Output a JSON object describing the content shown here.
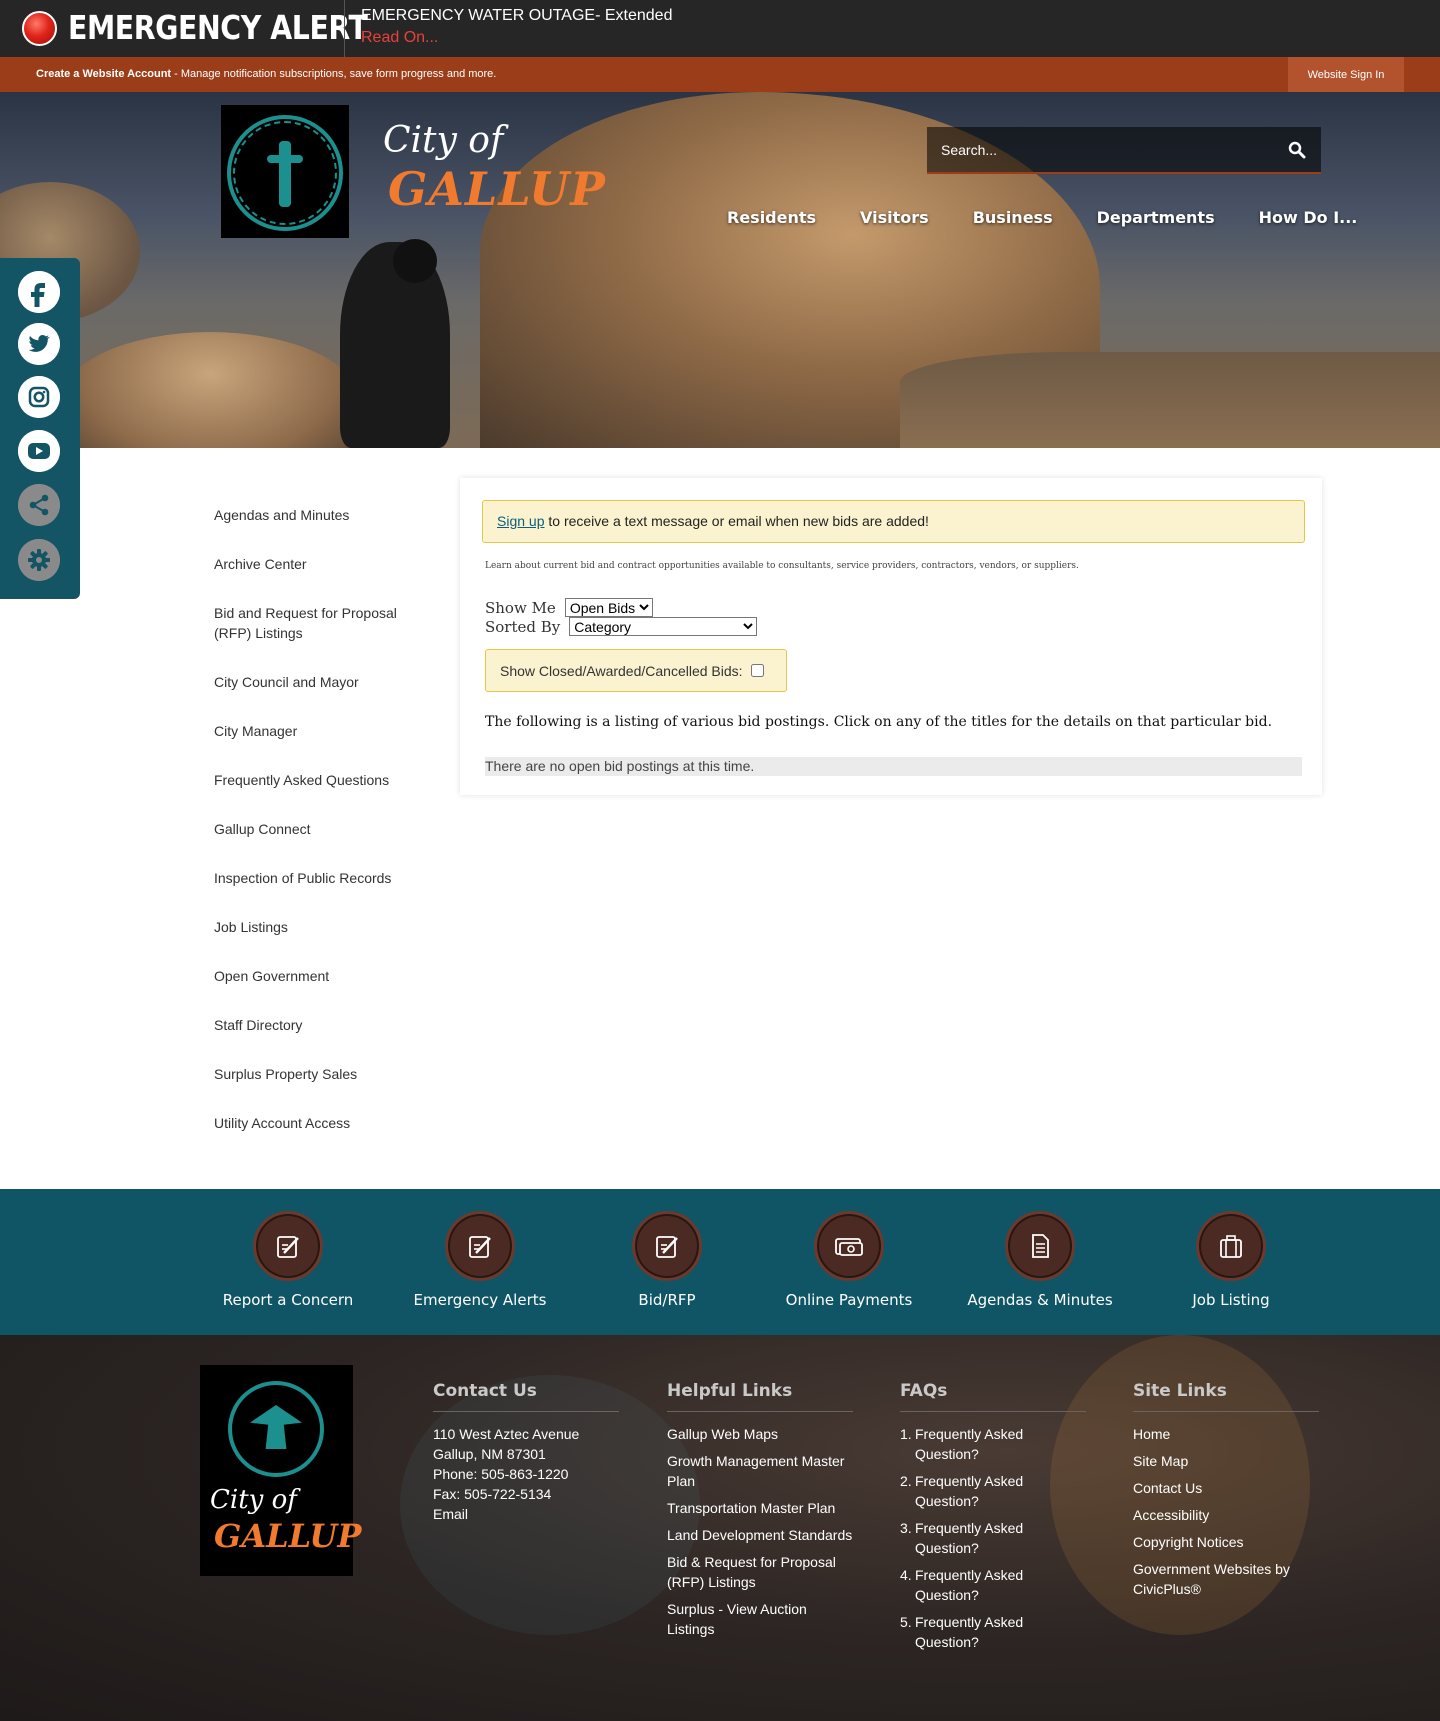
{
  "alert": {
    "title": "EMERGENCY ALERT",
    "message": "EMERGENCY WATER OUTAGE- Extended",
    "read_on": "Read On..."
  },
  "account_bar": {
    "create_label": "Create a Website Account",
    "create_desc": " - Manage notification subscriptions, save form progress and more.",
    "signin_label": "Website Sign In"
  },
  "header": {
    "city_of": "City of",
    "gallup": "GALLUP",
    "search_placeholder": "Search...",
    "nav": [
      "Residents",
      "Visitors",
      "Business",
      "Departments",
      "How Do I..."
    ]
  },
  "social": [
    {
      "icon": "facebook-icon"
    },
    {
      "icon": "twitter-icon"
    },
    {
      "icon": "instagram-icon"
    },
    {
      "icon": "youtube-icon"
    },
    {
      "icon": "share-icon"
    },
    {
      "icon": "gear-icon"
    }
  ],
  "sidenav": [
    "Agendas and Minutes",
    "Archive Center",
    "Bid and Request for Proposal (RFP) Listings",
    "City Council and Mayor",
    "City Manager",
    "Frequently Asked Questions",
    "Gallup Connect",
    "Inspection of Public Records",
    "Job Listings",
    "Open Government",
    "Staff Directory",
    "Surplus Property Sales",
    "Utility Account Access"
  ],
  "content": {
    "signup_link": "Sign up",
    "signup_rest": " to receive a text message or email when new bids are added!",
    "intro": "Learn about current bid and contract opportunities available to consultants, service providers, contractors, vendors, or suppliers.",
    "show_me_label": "Show Me",
    "show_me_value": "Open Bids",
    "sorted_by_label": "Sorted By",
    "sorted_by_value": "Category",
    "closed_label": "Show Closed/Awarded/Cancelled Bids:",
    "listing_text": "The following is a listing of various bid postings. Click on any of the titles for the details on that particular bid.",
    "no_bids": "There are no open bid postings at this time."
  },
  "quick_links": [
    {
      "label": "Report a Concern",
      "icon": "edit-document-icon"
    },
    {
      "label": "Emergency Alerts",
      "icon": "edit-document-icon"
    },
    {
      "label": "Bid/RFP",
      "icon": "edit-document-icon"
    },
    {
      "label": "Online Payments",
      "icon": "payment-card-icon"
    },
    {
      "label": "Agendas & Minutes",
      "icon": "document-icon"
    },
    {
      "label": "Job Listing",
      "icon": "briefcase-icon"
    }
  ],
  "footer": {
    "logo_city": "City of",
    "logo_gallup": "GALLUP",
    "contact": {
      "title": "Contact Us",
      "address1": "110 West Aztec Avenue",
      "address2": "Gallup, NM 87301",
      "phone": "Phone: 505-863-1220",
      "fax": "Fax: 505-722-5134",
      "email": "Email"
    },
    "helpful": {
      "title": "Helpful Links",
      "links": [
        "Gallup Web Maps",
        "Growth Management Master Plan",
        "Transportation Master Plan",
        "Land Development Standards",
        "Bid & Request for Proposal (RFP) Listings",
        "Surplus - View Auction Listings"
      ]
    },
    "faqs": {
      "title": "FAQs",
      "items": [
        {
          "num": "1.",
          "text": "Frequently Asked Question?"
        },
        {
          "num": "2.",
          "text": "Frequently Asked Question?"
        },
        {
          "num": "3.",
          "text": "Frequently Asked Question?"
        },
        {
          "num": "4.",
          "text": "Frequently Asked Question?"
        },
        {
          "num": "5.",
          "text": "Frequently Asked Question?"
        }
      ]
    },
    "site": {
      "title": "Site Links",
      "links": [
        "Home",
        "Site Map",
        "Contact Us",
        "Accessibility",
        "Copyright Notices",
        "Government Websites by CivicPlus®"
      ]
    }
  },
  "colors": {
    "alert_bg": "#262626",
    "alert_accent": "#e8413a",
    "account_bar": "#9c3d1a",
    "teal": "#0f5565",
    "orange": "#f07a2e",
    "notice_bg": "#fbf3cf"
  }
}
